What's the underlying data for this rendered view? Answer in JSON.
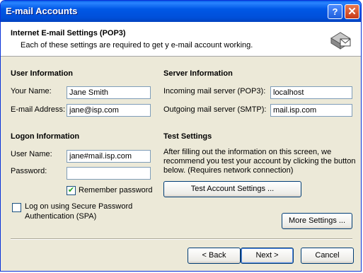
{
  "window": {
    "title": "E-mail Accounts"
  },
  "header": {
    "title": "Internet E-mail Settings (POP3)",
    "subtitle": "Each of these settings are required to get y e-mail account working."
  },
  "user_info": {
    "heading": "User Information",
    "name_label": "Your Name:",
    "name_value": "Jane Smith",
    "email_label": "E-mail Address:",
    "email_value": "jane@isp.com"
  },
  "server_info": {
    "heading": "Server Information",
    "incoming_label": "Incoming mail server (POP3):",
    "incoming_value": "localhost",
    "outgoing_label": "Outgoing mail server (SMTP):",
    "outgoing_value": "mail.isp.com"
  },
  "logon_info": {
    "heading": "Logon Information",
    "username_label": "User Name:",
    "username_value": "jane#mail.isp.com",
    "password_label": "Password:",
    "password_value": "",
    "remember_label": "Remember password",
    "remember_checked": true,
    "spa_label_1": "Log on using Secure Password",
    "spa_label_2": "Authentication (SPA)",
    "spa_checked": false
  },
  "test_settings": {
    "heading": "Test Settings",
    "desc_1": "After filling out the information on this screen, we",
    "desc_2": "recommend you test your account by clicking the button",
    "desc_3": "below. (Requires network connection)",
    "button": "Test Account Settings ..."
  },
  "buttons": {
    "more": "More Settings ...",
    "back": "< Back",
    "next": "Next >",
    "cancel": "Cancel"
  }
}
